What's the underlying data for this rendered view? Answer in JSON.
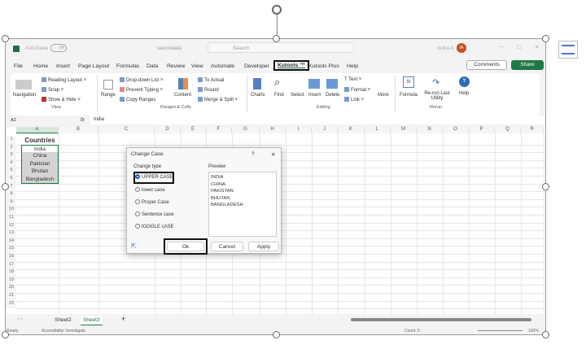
{
  "titlebar": {
    "autosave": "AutoSave",
    "toggle": "Off",
    "filename": "secondata",
    "search": "Search",
    "user": "Indra A",
    "initials": "IA"
  },
  "tabs": [
    "File",
    "Home",
    "Insert",
    "Page Layout",
    "Formulas",
    "Data",
    "Review",
    "View",
    "Automate",
    "Developer",
    "Kutools ™",
    "Kutools Plus",
    "Help"
  ],
  "buttons": {
    "comments": "Comments",
    "share": "Share"
  },
  "ribbon": {
    "navigation": "Navigation",
    "reading_layout": "Reading Layout",
    "snap": "Snap",
    "show_hide": "Show & Hide",
    "view_group": "View",
    "range": "Range",
    "dropdown_list": "Drop-down List",
    "prevent_typing": "Prevent Typing",
    "copy_ranges": "Copy Ranges",
    "content": "Content",
    "to_actual": "To Actual",
    "round": "Round",
    "merge_split": "Merge & Split",
    "ranges_group": "Ranges & Cells",
    "charts": "Charts",
    "find": "Find",
    "select": "Select",
    "insert": "Insert",
    "delete": "Delete",
    "text": "Text",
    "format": "Format",
    "link": "Link",
    "more": "More",
    "editing_group": "Editing",
    "formula": "Formula",
    "rerun": "Re-run Last Utility",
    "rerun_group": "Rerun",
    "help": "Help"
  },
  "formula_bar": {
    "cell_ref": "A2",
    "fx": "fx",
    "value": "India"
  },
  "columns": [
    "A",
    "B",
    "C",
    "D",
    "E",
    "F",
    "G",
    "H",
    "I",
    "J",
    "K",
    "L",
    "M",
    "N",
    "O",
    "P",
    "Q",
    "R"
  ],
  "cells": [
    "Countries",
    "India",
    "China",
    "Pakistan",
    "Bhutan",
    "Bangladesh"
  ],
  "dialog": {
    "title": "Change Case",
    "help": "?",
    "close": "✕",
    "change_type": "Change type",
    "options": [
      "UPPER CASE",
      "lower case",
      "Proper Case",
      "Sentence case",
      "tOGGLE cASE"
    ],
    "preview_label": "Preview",
    "preview": [
      "INDIA",
      "CHINA",
      "PAKISTAN",
      "BHUTAN",
      "BANGLADESH"
    ],
    "ok": "Ok",
    "cancel": "Cancel",
    "apply": "Apply"
  },
  "sheets": [
    "Sheet2",
    "Sheet3"
  ],
  "add_sheet": "+",
  "status": {
    "ready": "Ready",
    "accessibility": "Accessibility: Investigate",
    "count": "Count: 5",
    "zoom": "100%"
  }
}
